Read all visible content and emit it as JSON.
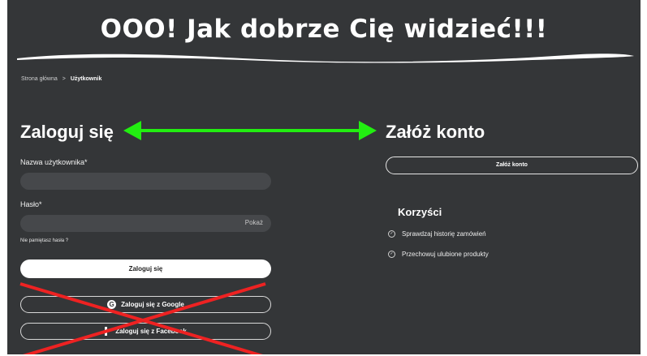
{
  "banner": {
    "title": "OOO! Jak dobrze Cię widzieć!!!"
  },
  "breadcrumb": {
    "home": "Strona główna",
    "separator": ">",
    "current": "Użytkownik"
  },
  "login": {
    "heading": "Zaloguj się",
    "username_label": "Nazwa użytkownika*",
    "username_value": "",
    "password_label": "Hasło*",
    "password_value": "",
    "show_label": "Pokaż",
    "forgot_label": "Nie pamiętasz hasła ?",
    "submit_label": "Zaloguj się",
    "google_label": "Zaloguj się z Google",
    "google_icon_glyph": "G",
    "facebook_label": "Zaloguj się z Facebook"
  },
  "register": {
    "heading": "Załóż konto",
    "button_label": "Załóż konto",
    "benefits_title": "Korzyści",
    "benefits": [
      {
        "icon": "check-circle-icon",
        "glyph": "✓",
        "text": "Sprawdzaj historię zamówień"
      },
      {
        "icon": "check-circle-icon",
        "glyph": "✓",
        "text": "Przechowuj ulubione produkty"
      }
    ]
  },
  "annotations": {
    "arrow_color": "#22ee11",
    "cross_color": "#ee2222"
  },
  "colors": {
    "background": "#343638",
    "field": "#46484b",
    "text": "#ffffff"
  }
}
